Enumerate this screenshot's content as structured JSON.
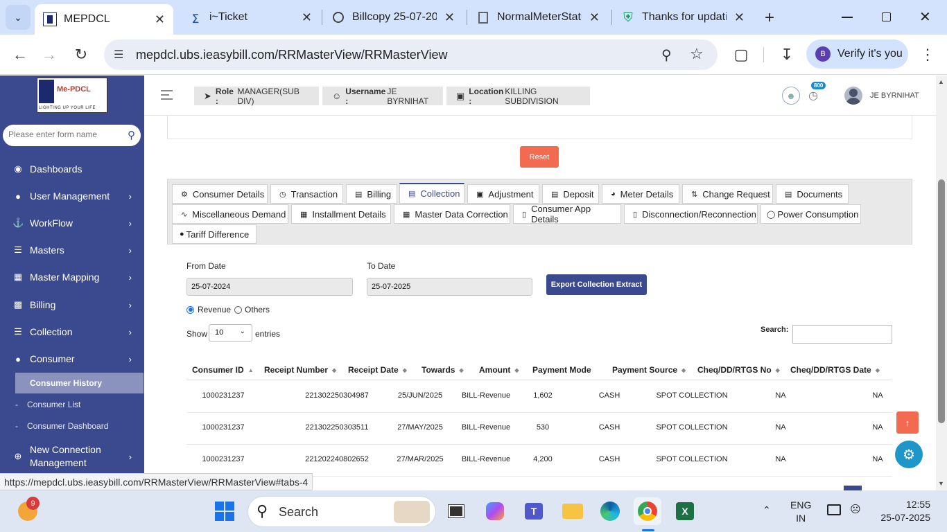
{
  "browser": {
    "tabs": [
      {
        "title": "MEPDCL",
        "icon": "mepdcl-favicon-icon",
        "active": true
      },
      {
        "title": "i~Ticket",
        "icon": "iticket-favicon-icon"
      },
      {
        "title": "Billcopy 25-07-20",
        "icon": "globe-icon"
      },
      {
        "title": "NormalMeterStatu",
        "icon": "document-icon"
      },
      {
        "title": "Thanks for updati",
        "icon": "shield-check-icon"
      }
    ],
    "url": "mepdcl.ubs.ieasybill.com/RRMasterView/RRMasterView",
    "verify_label": "Verify it's you",
    "profile_initial": "B"
  },
  "sidebar": {
    "logo_text": "Me-PDCL",
    "logo_tagline": "LIGHTING UP YOUR LIFE",
    "search_placeholder": "Please enter form name",
    "items": [
      {
        "label": "Dashboards",
        "icon": "palette-icon",
        "chevron": false
      },
      {
        "label": "User Management",
        "icon": "user-icon",
        "chevron": true
      },
      {
        "label": "WorkFlow",
        "icon": "anchor-icon",
        "chevron": true
      },
      {
        "label": "Masters",
        "icon": "list-icon",
        "chevron": true
      },
      {
        "label": "Master Mapping",
        "icon": "sitemap-icon",
        "chevron": true
      },
      {
        "label": "Billing",
        "icon": "bill-icon",
        "chevron": true
      },
      {
        "label": "Collection",
        "icon": "list-check-icon",
        "chevron": true
      },
      {
        "label": "Consumer",
        "icon": "user-icon",
        "chevron": true
      }
    ],
    "subitems": [
      {
        "label": "Consumer History",
        "active": true
      },
      {
        "label": "Consumer List",
        "active": false
      },
      {
        "label": "Consumer Dashboard",
        "active": false
      }
    ],
    "bottom_item": {
      "label_line1": "New Connection",
      "label_line2": "Management",
      "icon": "plus-circle-icon"
    }
  },
  "header": {
    "role_label": "Role :",
    "role_value": "MANAGER(SUB DIV)",
    "username_label": "Username :",
    "username_value": "JE BYRNIHAT",
    "location_label": "Location :",
    "location_value": "KILLING SUBDIVISION",
    "notification_count": "800",
    "user_name": "JE BYRNIHAT"
  },
  "content": {
    "reset_label": "Reset",
    "tabs_row1": [
      "Consumer Details",
      "Transaction",
      "Billing",
      "Collection",
      "Adjustment",
      "Deposit",
      "Meter Details",
      "Change Request",
      "Documents"
    ],
    "tabs_row2": [
      "Miscellaneous Demand",
      "Installment Details",
      "Master Data Correction",
      "Consumer App Details",
      "Disconnection/Reconnection",
      "Power Consumption"
    ],
    "tabs_row3": [
      "Tariff Difference"
    ],
    "active_tab": "Collection",
    "from_date_label": "From Date",
    "from_date_value": "25-07-2024",
    "to_date_label": "To Date",
    "to_date_value": "25-07-2025",
    "export_label": "Export Collection Extract",
    "radio_revenue": "Revenue",
    "radio_others": "Others",
    "show_label": "Show",
    "entries_value": "10",
    "entries_label": "entries",
    "search_label": "Search:",
    "table": {
      "columns": [
        "Consumer ID",
        "Receipt Number",
        "Receipt Date",
        "Towards",
        "Amount",
        "Payment Mode",
        "Payment Source",
        "Cheq/DD/RTGS No",
        "Cheq/DD/RTGS Date"
      ],
      "rows": [
        [
          "1000231237",
          "221302250304987",
          "25/JUN/2025",
          "BILL-Revenue",
          "1,602",
          "CASH",
          "SPOT COLLECTION",
          "NA",
          "NA"
        ],
        [
          "1000231237",
          "221302250303511",
          "27/MAY/2025",
          "BILL-Revenue",
          "530",
          "CASH",
          "SPOT COLLECTION",
          "NA",
          "NA"
        ],
        [
          "1000231237",
          "221202240802652",
          "27/MAR/2025",
          "BILL-Revenue",
          "4,200",
          "CASH",
          "SPOT COLLECTION",
          "NA",
          "NA"
        ]
      ]
    }
  },
  "status_url": "https://mepdcl.ubs.ieasybill.com/RRMasterView/RRMasterView#tabs-4",
  "taskbar": {
    "weather_badge": "9",
    "search_label": "Search",
    "lang_line1": "ENG",
    "lang_line2": "IN",
    "time": "12:55",
    "date": "25-07-2025"
  },
  "colors": {
    "sidebar": "#3b4a8e",
    "accent_button": "#f26a4f",
    "export_button": "#3b4a8e",
    "tabstrip": "#d3e3fd"
  }
}
